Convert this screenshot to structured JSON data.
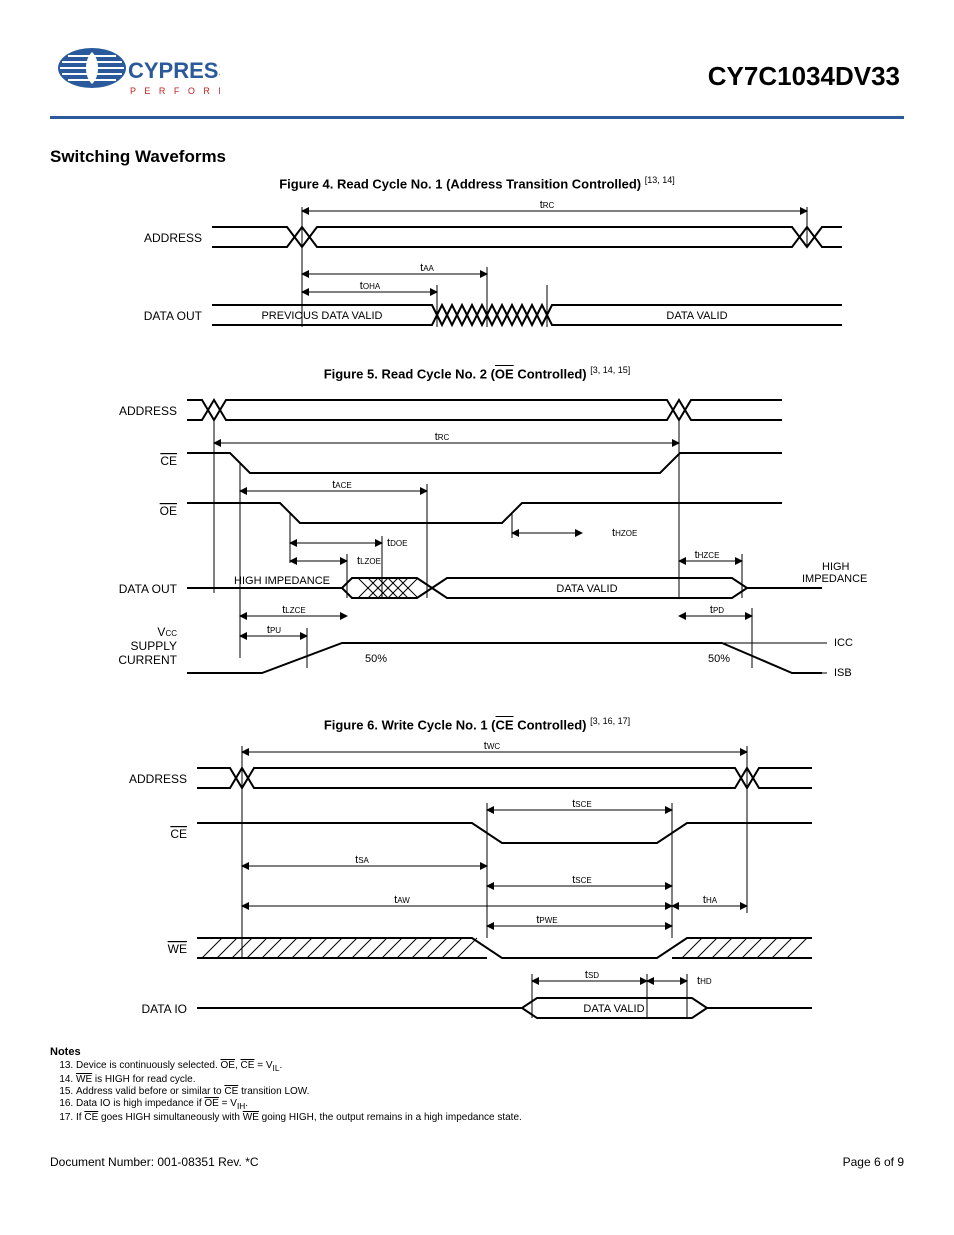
{
  "header": {
    "logo_main": "CYPRESS",
    "logo_sub": "P E R F O R M",
    "part_number": "CY7C1034DV33"
  },
  "section_title": "Switching Waveforms",
  "figures": {
    "fig4": {
      "caption_pre": "Figure 4.  Read Cycle No. 1 (Address Transition Controlled)",
      "refs": "[13, 14]",
      "signals": {
        "address": "ADDRESS",
        "dataout": "DATA OUT"
      },
      "timings": {
        "trc": "RC",
        "taa": "AA",
        "toha": "OHA"
      },
      "text": {
        "prev": "PREVIOUS DATA VALID",
        "valid": "DATA VALID"
      }
    },
    "fig5": {
      "caption_a": "Figure 5.  Read Cycle No. 2 (",
      "caption_ov": "OE",
      "caption_b": " Controlled)",
      "refs": "[3, 14, 15]",
      "signals": {
        "address": "ADDRESS",
        "ce": "CE",
        "oe": "OE",
        "dataout": "DATA  OUT",
        "vcc1": "V",
        "vcc1sub": "CC",
        "vcc2": "SUPPLY",
        "vcc3": "CURRENT"
      },
      "timings": {
        "trc": "RC",
        "tace": "ACE",
        "tdoe": "DOE",
        "tlzoe": "LZOE",
        "tlzce": "LZCE",
        "thzoe": "HZOE",
        "thzce": "HZCE",
        "tpu": "PU",
        "tpd": "PD"
      },
      "text": {
        "hiz": "HIGH IMPEDANCE",
        "hiz2a": "HIGH",
        "hiz2b": "IMPEDANCE",
        "valid": "DATA VALID",
        "fifty": "50%",
        "icc": "ICC",
        "isb": "ISB"
      }
    },
    "fig6": {
      "caption_a": "Figure 6.  Write Cycle No. 1 (",
      "caption_ov": "CE",
      "caption_b": " Controlled)",
      "refs": "[3, 16, 17]",
      "signals": {
        "address": "ADDRESS",
        "ce": "CE",
        "we": "WE",
        "dataio": "DATA IO"
      },
      "timings": {
        "twc": "WC",
        "tsa": "SA",
        "taw": "AW",
        "tsce": "SCE",
        "tpwe": "PWE",
        "tha": "HA",
        "tsd": "SD",
        "thd": "HD"
      },
      "text": {
        "valid": "DATA VALID"
      }
    }
  },
  "notes": {
    "heading": "Notes",
    "n13a": "Device is continuously selected. ",
    "n13ov1": "OE",
    "n13mid": ", ",
    "n13ov2": "CE",
    "n13b": " = V",
    "n13sub": "IL",
    "n13c": ".",
    "n14ov": "WE",
    "n14b": " is HIGH for read cycle.",
    "n15a": "Address valid before or similar to ",
    "n15ov": "CE",
    "n15b": " transition LOW.",
    "n16a": "Data IO is high impedance if ",
    "n16ov": "OE",
    "n16b": " = V",
    "n16sub": "IH",
    "n16c": ".",
    "n17a": "If ",
    "n17ov1": "CE",
    "n17b": " goes HIGH simultaneously with ",
    "n17ov2": "WE",
    "n17c": " going HIGH, the output remains in a high impedance state."
  },
  "footer": {
    "docnum": "Document Number: 001-08351 Rev. *C",
    "page": "Page 6 of 9"
  }
}
